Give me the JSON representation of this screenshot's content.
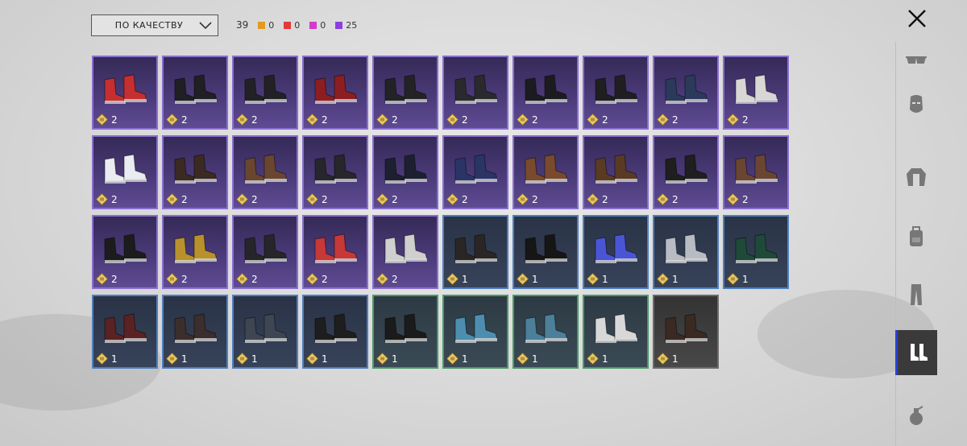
{
  "sort": {
    "label": "ПО КАЧЕСТВУ"
  },
  "total": "39",
  "quality_counts": [
    {
      "color": "#e39a1e",
      "count": "0"
    },
    {
      "color": "#e23a3a",
      "count": "0"
    },
    {
      "color": "#d23cc8",
      "count": "0"
    },
    {
      "color": "#8a3fe0",
      "count": "25"
    }
  ],
  "side_tabs": [
    "glasses-icon",
    "mask-icon",
    "jacket-icon",
    "backpack-icon",
    "pants-icon",
    "shoes-icon",
    "grenade-icon"
  ],
  "items": [
    {
      "rarity": "epic",
      "count": "2",
      "color": "#c62f2f"
    },
    {
      "rarity": "epic",
      "count": "2",
      "color": "#1f1f24"
    },
    {
      "rarity": "epic",
      "count": "2",
      "color": "#222226"
    },
    {
      "rarity": "epic",
      "count": "2",
      "color": "#8c1e22"
    },
    {
      "rarity": "epic",
      "count": "2",
      "color": "#232326"
    },
    {
      "rarity": "epic",
      "count": "2",
      "color": "#2a2a2e"
    },
    {
      "rarity": "epic",
      "count": "2",
      "color": "#1c1c20"
    },
    {
      "rarity": "epic",
      "count": "2",
      "color": "#1f1f22"
    },
    {
      "rarity": "epic",
      "count": "2",
      "color": "#2b3a5a"
    },
    {
      "rarity": "epic",
      "count": "2",
      "color": "#d9d6d6"
    },
    {
      "rarity": "epic",
      "count": "2",
      "color": "#e9ecf0"
    },
    {
      "rarity": "epic",
      "count": "2",
      "color": "#3b2a22"
    },
    {
      "rarity": "epic",
      "count": "2",
      "color": "#6a4630"
    },
    {
      "rarity": "epic",
      "count": "2",
      "color": "#26262b"
    },
    {
      "rarity": "epic",
      "count": "2",
      "color": "#1d2030"
    },
    {
      "rarity": "epic",
      "count": "2",
      "color": "#2a3566"
    },
    {
      "rarity": "epic",
      "count": "2",
      "color": "#7a4a2c"
    },
    {
      "rarity": "epic",
      "count": "2",
      "color": "#5b3a24"
    },
    {
      "rarity": "epic",
      "count": "2",
      "color": "#1e1f1e"
    },
    {
      "rarity": "epic",
      "count": "2",
      "color": "#6a4632"
    },
    {
      "rarity": "epic",
      "count": "2",
      "color": "#1c1c1c"
    },
    {
      "rarity": "epic",
      "count": "2",
      "color": "#b8912c"
    },
    {
      "rarity": "epic",
      "count": "2",
      "color": "#26262a"
    },
    {
      "rarity": "epic",
      "count": "2",
      "color": "#c73838"
    },
    {
      "rarity": "epic",
      "count": "2",
      "color": "#cfcfcf"
    },
    {
      "rarity": "rare",
      "count": "1",
      "color": "#2b2626"
    },
    {
      "rarity": "rare",
      "count": "1",
      "color": "#161616"
    },
    {
      "rarity": "rare",
      "count": "1",
      "color": "#4a55d6"
    },
    {
      "rarity": "rare",
      "count": "1",
      "color": "#b7bcc4"
    },
    {
      "rarity": "rare",
      "count": "1",
      "color": "#1f4a3a"
    },
    {
      "rarity": "rare",
      "count": "1",
      "color": "#5a2222"
    },
    {
      "rarity": "rare",
      "count": "1",
      "color": "#3b2e2c"
    },
    {
      "rarity": "rare",
      "count": "1",
      "color": "#3e4654"
    },
    {
      "rarity": "rare",
      "count": "1",
      "color": "#1e1e1e"
    },
    {
      "rarity": "uncommon",
      "count": "1",
      "color": "#1b1b1b"
    },
    {
      "rarity": "uncommon",
      "count": "1",
      "color": "#4d8eb0"
    },
    {
      "rarity": "uncommon",
      "count": "1",
      "color": "#4b7f9a"
    },
    {
      "rarity": "uncommon",
      "count": "1",
      "color": "#d8d8d8"
    },
    {
      "rarity": "common",
      "count": "1",
      "color": "#3a2a22"
    }
  ]
}
